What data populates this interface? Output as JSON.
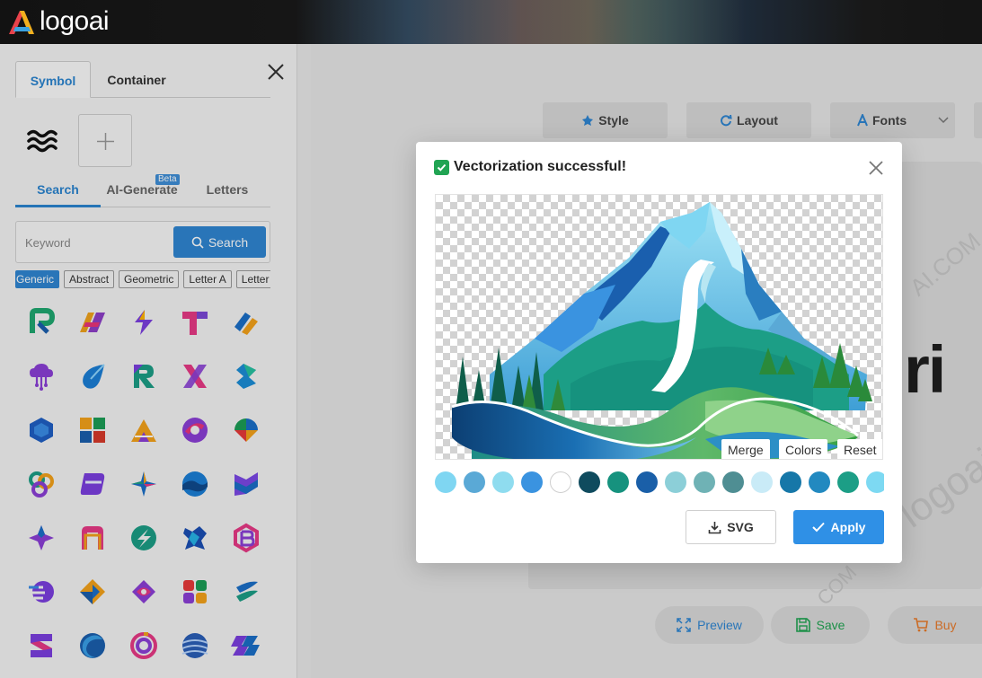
{
  "app": {
    "name": "logoai"
  },
  "left_panel": {
    "tabs": [
      "Symbol",
      "Container"
    ],
    "sub_tabs": [
      "Search",
      "AI-Generate",
      "Letters"
    ],
    "beta_badge": "Beta",
    "search": {
      "placeholder": "Keyword",
      "button_label": "Search"
    },
    "chips": [
      "Generic",
      "Abstract",
      "Geometric",
      "Letter A",
      "Letter B"
    ]
  },
  "toolbar": {
    "style": "Style",
    "layout": "Layout",
    "fonts": "Fonts"
  },
  "canvas": {
    "text_fragment": "ri",
    "watermark": "logoai",
    "watermark_2": "AI.COM",
    "watermark_3": "COM"
  },
  "bottom_actions": {
    "preview": "Preview",
    "save": "Save",
    "buy": "Buy"
  },
  "modal": {
    "title": "Vectorization successful!",
    "overlay_buttons": [
      "Merge",
      "Colors",
      "Reset"
    ],
    "palette": [
      "#7fd6f2",
      "#5aa9d6",
      "#8fdcef",
      "#3a93e0",
      "#ffffff",
      "#0f4b5e",
      "#16927e",
      "#1a5fa8",
      "#8ccfd8",
      "#6fb2b5",
      "#4f8e93",
      "#c9ebf7",
      "#1677a8",
      "#2289c0",
      "#1c9e86",
      "#7dd9f2"
    ],
    "svg_button": "SVG",
    "apply_button": "Apply"
  },
  "colors": {
    "accent": "#2f86d2",
    "apply": "#2f90e6",
    "success": "#21a453"
  }
}
